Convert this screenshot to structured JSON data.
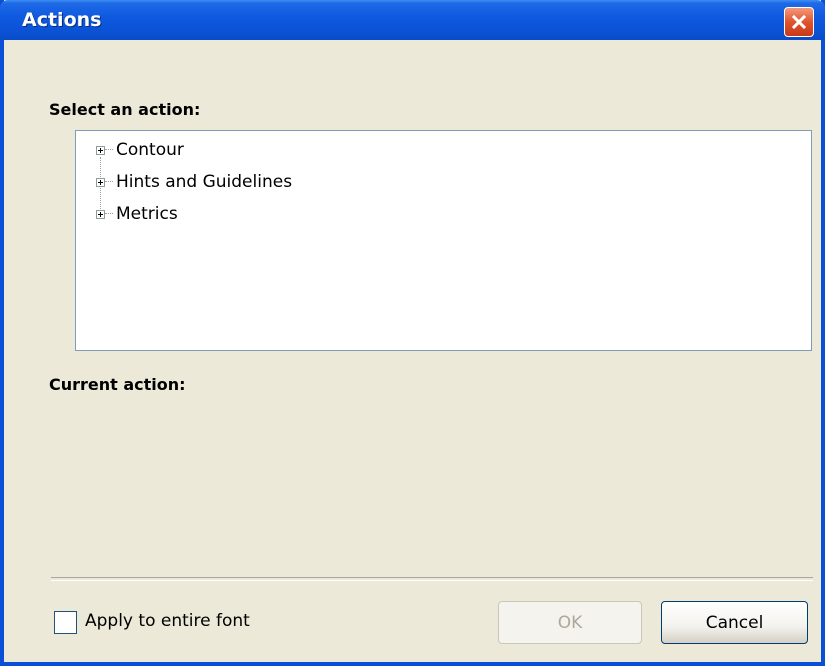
{
  "window": {
    "title": "Actions"
  },
  "select_label": "Select an action:",
  "tree": {
    "items": [
      {
        "label": "Contour"
      },
      {
        "label": "Hints and Guidelines"
      },
      {
        "label": "Metrics"
      }
    ]
  },
  "current_action_label": "Current action:",
  "footer": {
    "apply_checkbox_label": "Apply to entire font",
    "apply_checked": false,
    "ok_label": "OK",
    "ok_enabled": false,
    "cancel_label": "Cancel"
  },
  "colors": {
    "titlebar": "#0b54d8",
    "close_button": "#e0542c",
    "window_bg": "#ece9d8"
  },
  "icons": [
    "close-icon",
    "expand-plus-icon"
  ]
}
